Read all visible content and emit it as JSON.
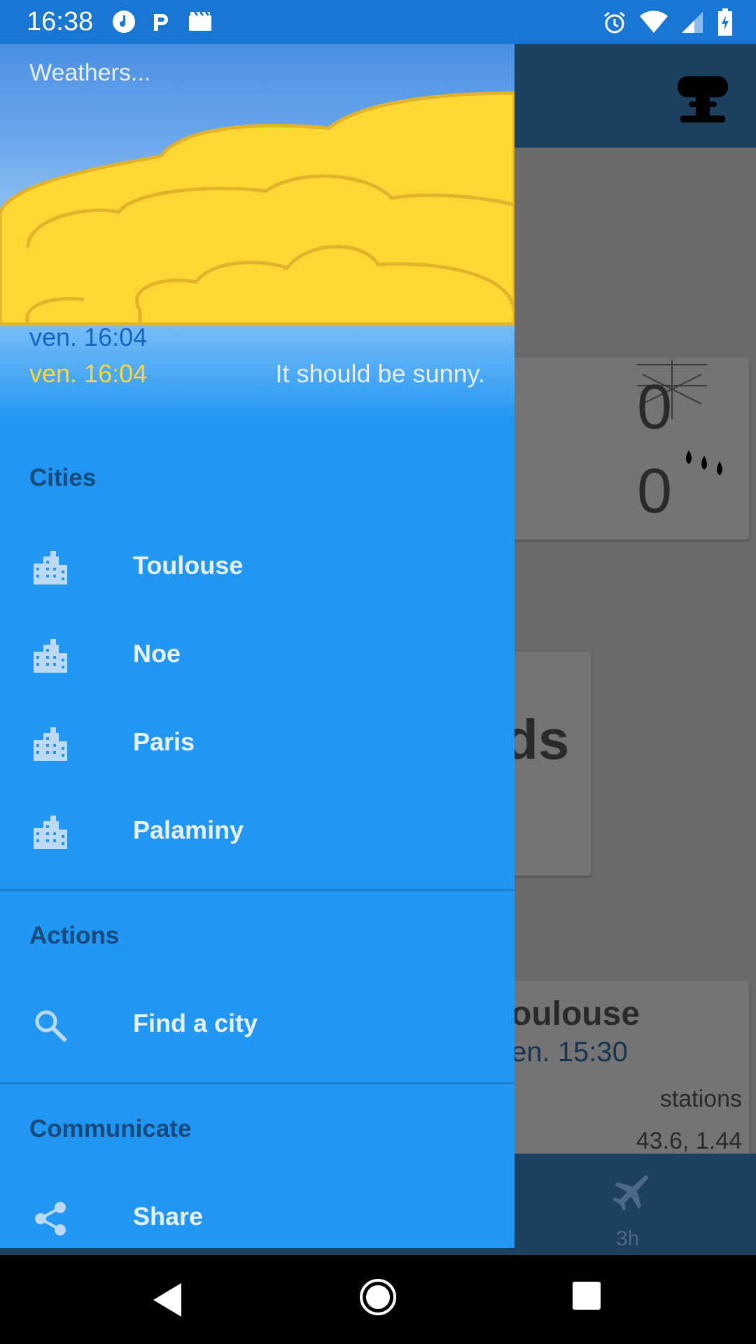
{
  "status_bar": {
    "time": "16:38"
  },
  "background_app": {
    "card1": {
      "value_top": "0",
      "value_bottom": "0"
    },
    "card2": {
      "partial_text": "ds"
    },
    "card3": {
      "city_partial": "oulouse",
      "time_partial": "en. 15:30",
      "stations": "stations",
      "coords": "43.6, 1.44"
    },
    "bottom_nav": {
      "tab_label": "3h"
    }
  },
  "drawer": {
    "header": {
      "title": "Weathers...",
      "date_primary": "ven. 16:04",
      "date_secondary": "ven. 16:04",
      "message": "It should be sunny."
    },
    "sections": {
      "cities_title": "Cities",
      "actions_title": "Actions",
      "communicate_title": "Communicate"
    },
    "cities": [
      {
        "label": "Toulouse",
        "icon": "city-icon"
      },
      {
        "label": "Noe",
        "icon": "city-icon"
      },
      {
        "label": "Paris",
        "icon": "city-icon"
      },
      {
        "label": "Palaminy",
        "icon": "city-icon"
      }
    ],
    "actions": [
      {
        "label": "Find a city",
        "icon": "search-icon"
      }
    ],
    "communicate": [
      {
        "label": "Share",
        "icon": "share-icon"
      }
    ]
  },
  "colors": {
    "drawer_bg": "#2196f3",
    "status_bar": "#1976d2",
    "date_yellow": "#fdd835",
    "section_title": "#174a7c"
  }
}
